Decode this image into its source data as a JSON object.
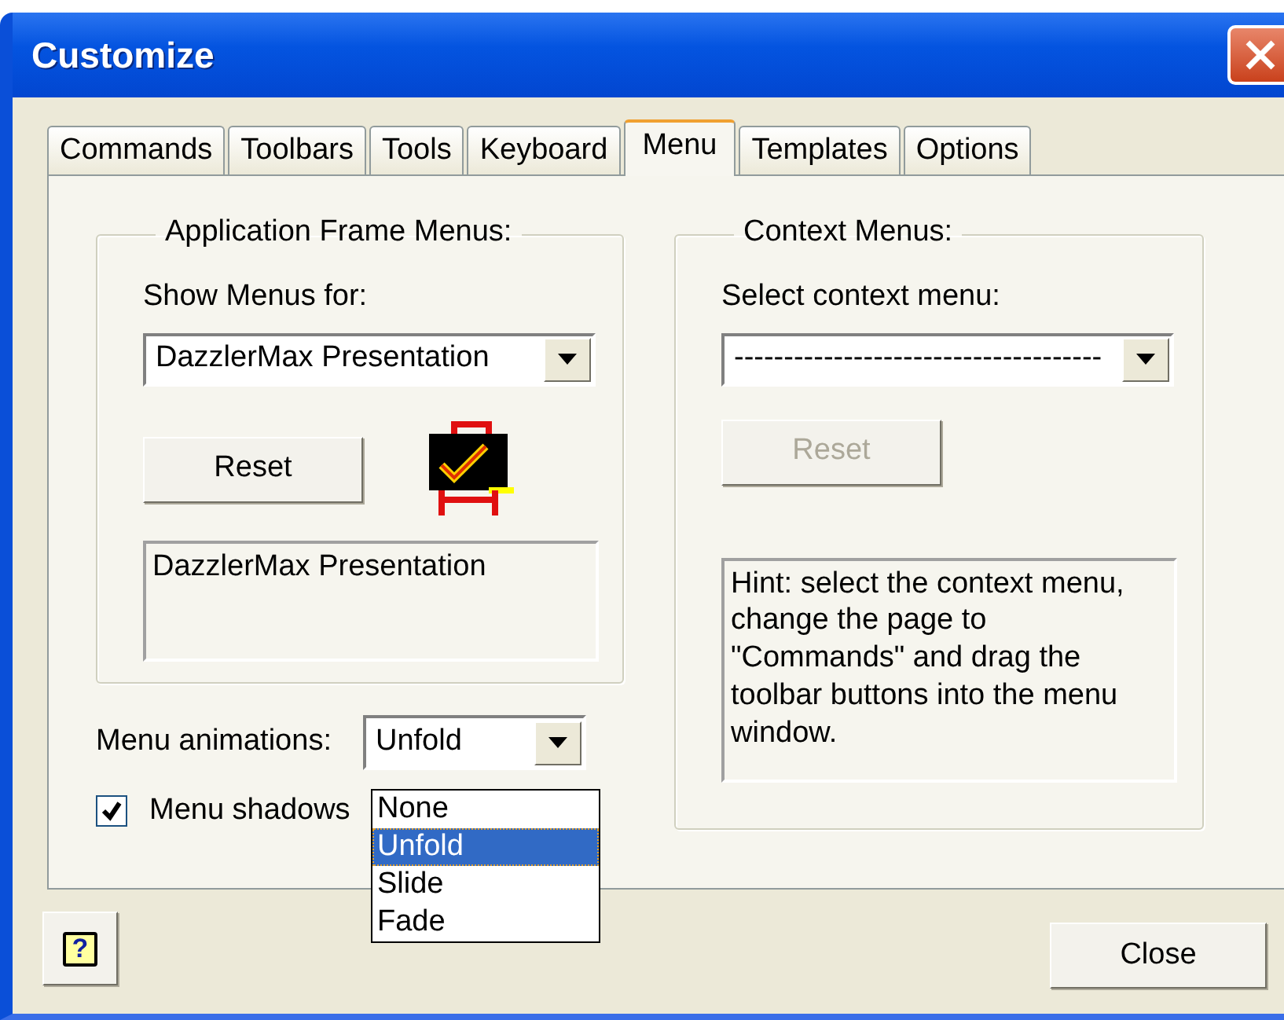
{
  "window": {
    "title": "Customize"
  },
  "tabs": [
    {
      "label": "Commands",
      "selected": false
    },
    {
      "label": "Toolbars",
      "selected": false
    },
    {
      "label": "Tools",
      "selected": false
    },
    {
      "label": "Keyboard",
      "selected": false
    },
    {
      "label": "Menu",
      "selected": true
    },
    {
      "label": "Templates",
      "selected": false
    },
    {
      "label": "Options",
      "selected": false
    }
  ],
  "app_frame_menus": {
    "title": "Application Frame Menus:",
    "show_label": "Show Menus for:",
    "show_value": "DazzlerMax Presentation",
    "reset": {
      "label": "Reset",
      "disabled": false
    },
    "description": "DazzlerMax Presentation"
  },
  "context_menus": {
    "title": "Context Menus:",
    "select_label": "Select context menu:",
    "select_value": "-------------------------------------",
    "reset": {
      "label": "Reset",
      "disabled": true
    },
    "hint": "Hint: select the context menu, change the page to \"Commands\" and drag the toolbar buttons into the menu window."
  },
  "menu_animations": {
    "label": "Menu animations:",
    "value": "Unfold",
    "expanded": true,
    "options": [
      {
        "label": "None",
        "selected": false
      },
      {
        "label": "Unfold",
        "selected": true
      },
      {
        "label": "Slide",
        "selected": false
      },
      {
        "label": "Fade",
        "selected": false
      }
    ]
  },
  "menu_shadows": {
    "label": "Menu shadows",
    "checked": true
  },
  "help_button": {
    "label": "?"
  },
  "close_button": {
    "label": "Close"
  }
}
